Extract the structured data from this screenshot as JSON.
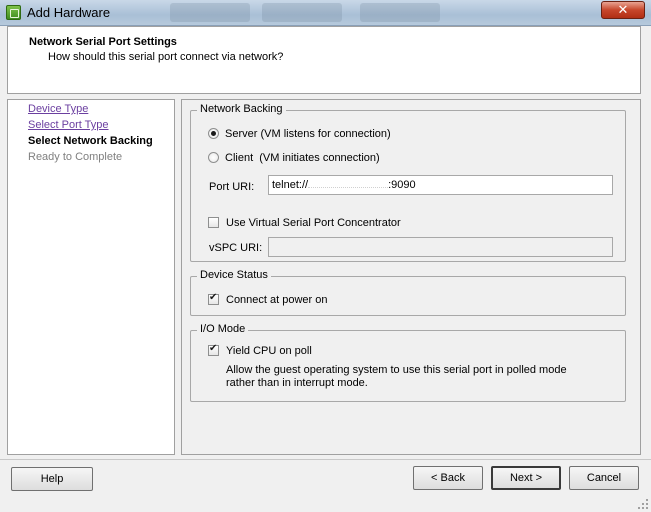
{
  "window": {
    "title": "Add Hardware",
    "close_label": "✕"
  },
  "header": {
    "title": "Network Serial Port Settings",
    "subtitle": "How should this serial port connect via network?"
  },
  "nav": {
    "items": [
      {
        "label": "Device Type",
        "state": "link"
      },
      {
        "label": "Select Port Type",
        "state": "link"
      },
      {
        "label": "Select Network Backing",
        "state": "current"
      },
      {
        "label": "Ready to Complete",
        "state": "disabled"
      }
    ]
  },
  "network_backing": {
    "group_title": "Network Backing",
    "server": {
      "label": "Server",
      "desc": "(VM listens for connection)",
      "selected": true
    },
    "client": {
      "label": "Client",
      "desc": "(VM initiates connection)",
      "selected": false
    },
    "port_uri": {
      "label": "Port URI:",
      "prefix": "telnet://",
      "suffix": ":9090"
    },
    "vspc": {
      "checkbox_label": "Use Virtual Serial Port Concentrator",
      "checked": false,
      "uri_label": "vSPC URI:",
      "uri_value": ""
    }
  },
  "device_status": {
    "group_title": "Device Status",
    "connect_label": "Connect at power on",
    "connect_checked": true
  },
  "io_mode": {
    "group_title": "I/O Mode",
    "yield_label": "Yield CPU on poll",
    "yield_checked": true,
    "desc_line1": "Allow the guest operating system to use this serial port in polled mode",
    "desc_line2": "rather than in interrupt mode."
  },
  "footer": {
    "help": "Help",
    "back": "< Back",
    "next": "Next >",
    "cancel": "Cancel"
  }
}
